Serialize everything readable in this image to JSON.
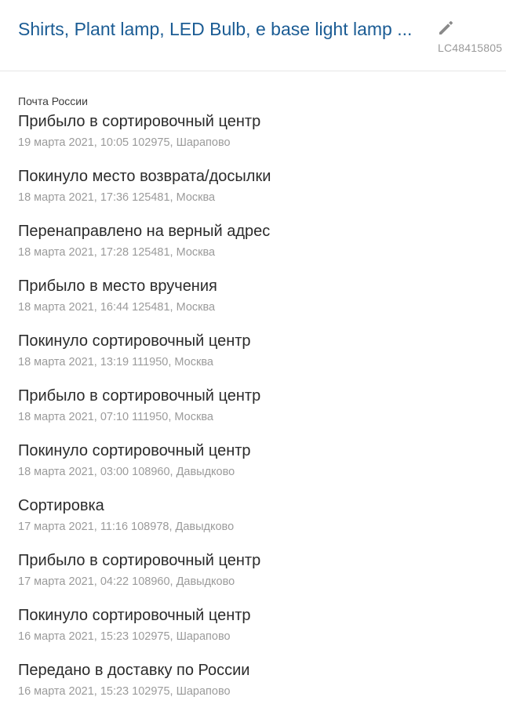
{
  "header": {
    "title": "Shirts, Plant lamp, LED Bulb, e base light lamp ...",
    "track_code": "LC48415805"
  },
  "carrier": "Почта России",
  "events": [
    {
      "title": "Прибыло в сортировочный центр",
      "meta": "19 марта 2021, 10:05 102975, Шарапово"
    },
    {
      "title": "Покинуло место возврата/досылки",
      "meta": "18 марта 2021, 17:36 125481, Москва"
    },
    {
      "title": "Перенаправлено на верный адрес",
      "meta": "18 марта 2021, 17:28 125481, Москва"
    },
    {
      "title": "Прибыло в место вручения",
      "meta": "18 марта 2021, 16:44 125481, Москва"
    },
    {
      "title": "Покинуло сортировочный центр",
      "meta": "18 марта 2021, 13:19 111950, Москва"
    },
    {
      "title": "Прибыло в сортировочный центр",
      "meta": "18 марта 2021, 07:10 111950, Москва"
    },
    {
      "title": "Покинуло сортировочный центр",
      "meta": "18 марта 2021, 03:00 108960, Давыдково"
    },
    {
      "title": "Сортировка",
      "meta": "17 марта 2021, 11:16 108978, Давыдково"
    },
    {
      "title": "Прибыло в сортировочный центр",
      "meta": "17 марта 2021, 04:22 108960, Давыдково"
    },
    {
      "title": "Покинуло сортировочный центр",
      "meta": "16 марта 2021, 15:23 102975, Шарапово"
    },
    {
      "title": "Передано в доставку по России",
      "meta": "16 марта 2021, 15:23 102975, Шарапово"
    }
  ],
  "colors": {
    "title": "#1b5c94",
    "event_title": "#2b2b2b",
    "meta": "#9b9b9b",
    "icon": "#8a8a8a",
    "divider": "#e6e6e6"
  },
  "icons": {
    "edit": "pencil-icon"
  }
}
